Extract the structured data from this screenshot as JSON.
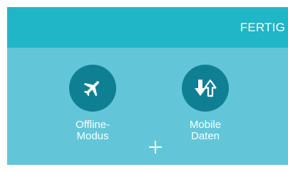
{
  "header": {
    "done_label": "FERTIG"
  },
  "tiles": [
    {
      "icon": "airplane-icon",
      "label": "Offline-\nModus"
    },
    {
      "icon": "mobile-data-icon",
      "label": "Mobile\nDaten"
    }
  ],
  "add_icon": "plus-icon",
  "colors": {
    "header": "#1fb6c7",
    "body": "#62c6d8",
    "circle": "#0f7f93",
    "text": "#ffffff"
  }
}
